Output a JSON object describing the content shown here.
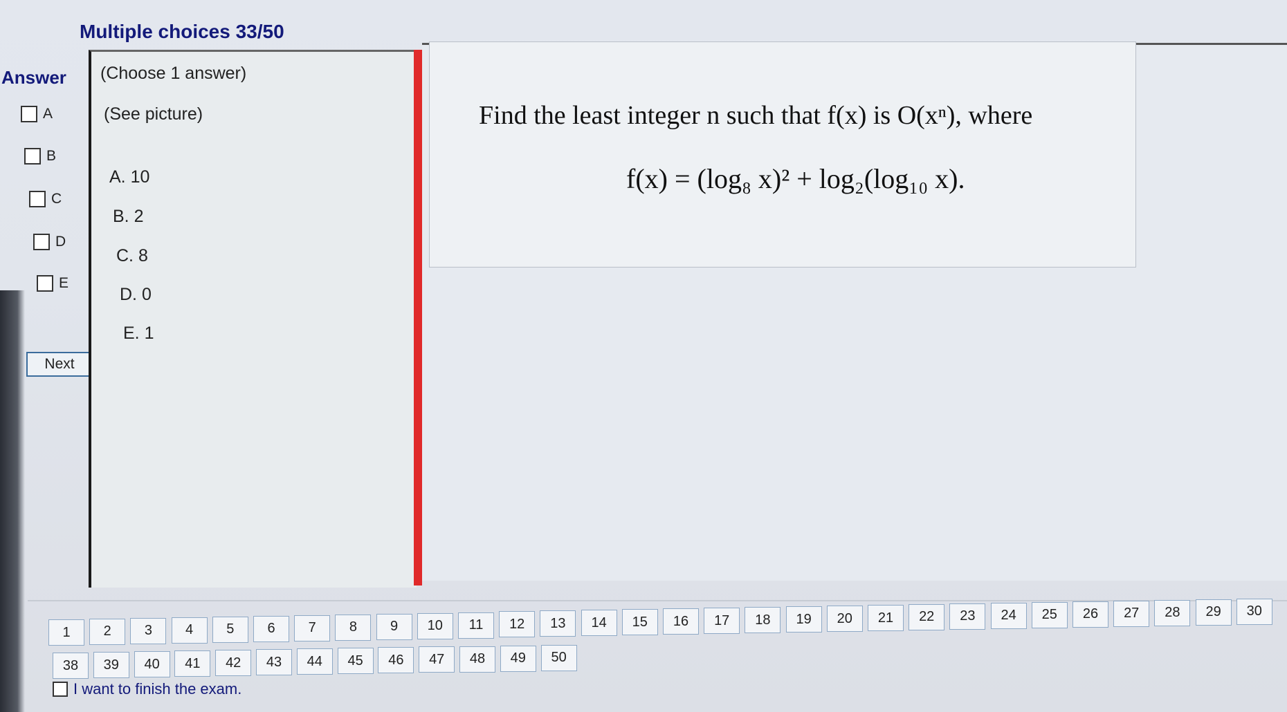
{
  "header": {
    "title": "Multiple choices 33/50"
  },
  "answer": {
    "label": "Answer",
    "options": [
      "A",
      "B",
      "C",
      "D",
      "E"
    ],
    "next_label": "Next"
  },
  "middle": {
    "instruction": "(Choose 1 answer)",
    "see_picture": "(See picture)",
    "choices": [
      "A. 10",
      "B. 2",
      "C. 8",
      "D. 0",
      "E. 1"
    ]
  },
  "question": {
    "text": "Find the least integer n such that f(x) is O(xⁿ), where",
    "formula": "f(x) = (log₈ x)² + log₂(log₁₀ x)."
  },
  "navigation": {
    "row1": [
      "1",
      "2",
      "3",
      "4",
      "5",
      "6",
      "7",
      "8",
      "9",
      "10",
      "11",
      "12",
      "13",
      "14",
      "15",
      "16",
      "17",
      "18",
      "19",
      "20",
      "21",
      "22",
      "23",
      "24",
      "25",
      "26",
      "27",
      "28",
      "29",
      "30"
    ],
    "row2": [
      "38",
      "39",
      "40",
      "41",
      "42",
      "43",
      "44",
      "45",
      "46",
      "47",
      "48",
      "49",
      "50"
    ]
  },
  "footer": {
    "finish_label": "I want to finish the exam."
  }
}
